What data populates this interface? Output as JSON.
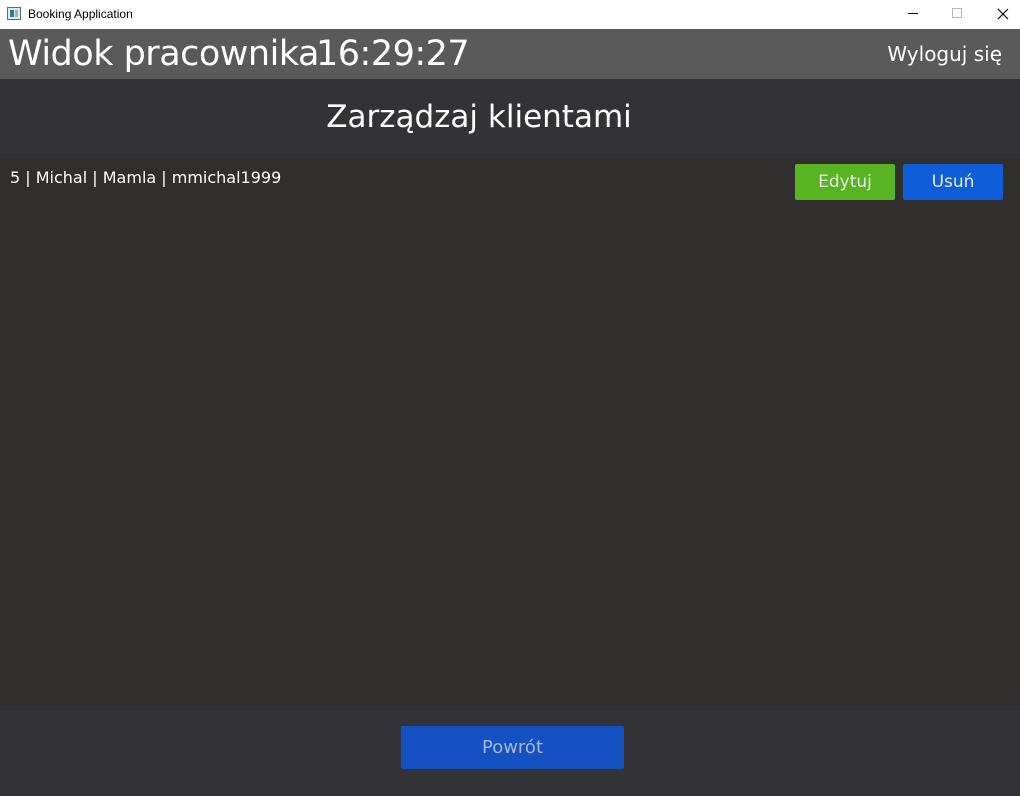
{
  "window": {
    "title": "Booking Application"
  },
  "header": {
    "title": "Widok pracownika",
    "clock": "16:29:27",
    "logout_label": "Wyloguj się"
  },
  "main": {
    "title": "Zarządzaj klientami",
    "clients": [
      {
        "text": "5 | Michal | Mamla | mmichal1999",
        "edit_label": "Edytuj",
        "delete_label": "Usuń"
      }
    ]
  },
  "footer": {
    "back_label": "Powrót"
  },
  "colors": {
    "background": "#333236",
    "header_bg": "#5a5a5a",
    "edit_button": "#58b420",
    "delete_button": "#0f5dd9",
    "back_button": "#1350c2"
  }
}
